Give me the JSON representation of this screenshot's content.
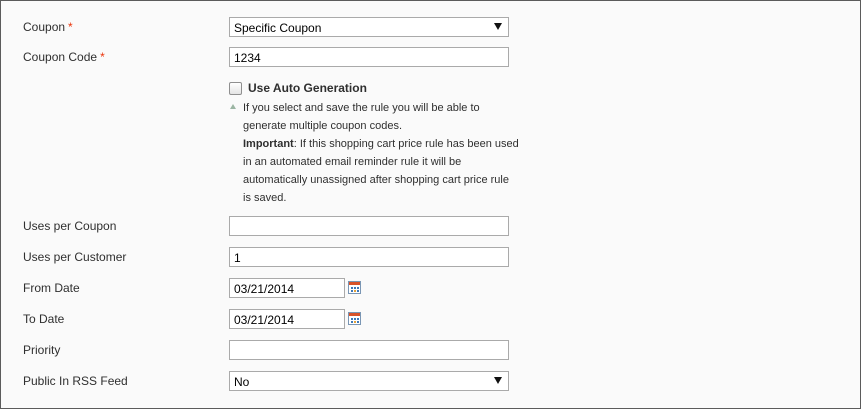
{
  "coupon": {
    "label": "Coupon",
    "required_mark": "*",
    "value": "Specific Coupon"
  },
  "coupon_code": {
    "label": "Coupon Code",
    "required_mark": "*",
    "value": "1234"
  },
  "auto_generation": {
    "label": "Use Auto Generation",
    "checked": false,
    "note": "If you select and save the rule you will be able to generate multiple coupon codes.",
    "important_label": "Important",
    "important_text": ": If this shopping cart price rule has been used in an automated email reminder rule it will be automatically unassigned after shopping cart price rule is saved."
  },
  "uses_per_coupon": {
    "label": "Uses per Coupon",
    "value": ""
  },
  "uses_per_customer": {
    "label": "Uses per Customer",
    "value": "1"
  },
  "from_date": {
    "label": "From Date",
    "value": "03/21/2014",
    "icon": "calendar-icon"
  },
  "to_date": {
    "label": "To Date",
    "value": "03/21/2014",
    "icon": "calendar-icon"
  },
  "priority": {
    "label": "Priority",
    "value": ""
  },
  "public_rss": {
    "label": "Public In RSS Feed",
    "value": "No"
  },
  "colors": {
    "required": "#eb340a",
    "border": "#aaaaaa",
    "frame": "#5b5b5b",
    "background": "#fafafa"
  }
}
